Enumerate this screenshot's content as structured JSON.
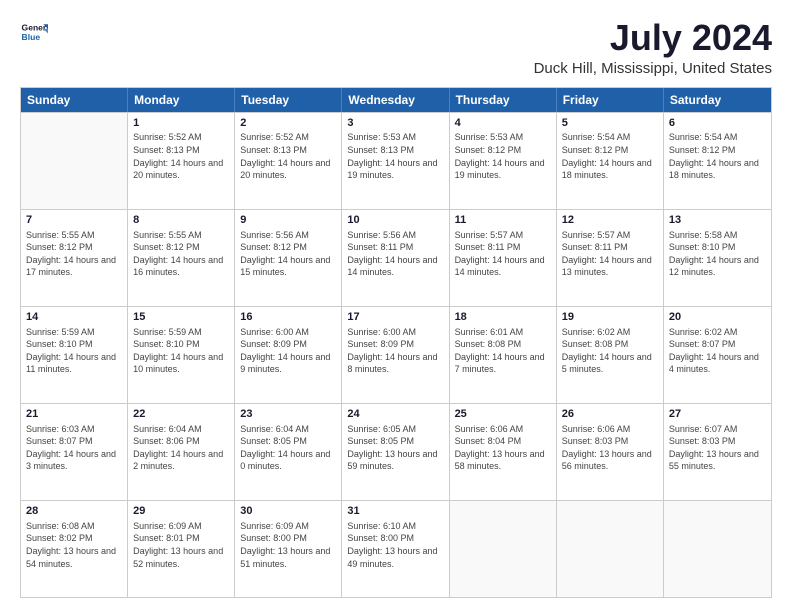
{
  "header": {
    "logo_line1": "General",
    "logo_line2": "Blue",
    "title": "July 2024",
    "subtitle": "Duck Hill, Mississippi, United States"
  },
  "weekdays": [
    "Sunday",
    "Monday",
    "Tuesday",
    "Wednesday",
    "Thursday",
    "Friday",
    "Saturday"
  ],
  "weeks": [
    [
      {
        "day": "",
        "empty": true
      },
      {
        "day": "1",
        "sunrise": "5:52 AM",
        "sunset": "8:13 PM",
        "daylight": "14 hours and 20 minutes."
      },
      {
        "day": "2",
        "sunrise": "5:52 AM",
        "sunset": "8:13 PM",
        "daylight": "14 hours and 20 minutes."
      },
      {
        "day": "3",
        "sunrise": "5:53 AM",
        "sunset": "8:13 PM",
        "daylight": "14 hours and 19 minutes."
      },
      {
        "day": "4",
        "sunrise": "5:53 AM",
        "sunset": "8:12 PM",
        "daylight": "14 hours and 19 minutes."
      },
      {
        "day": "5",
        "sunrise": "5:54 AM",
        "sunset": "8:12 PM",
        "daylight": "14 hours and 18 minutes."
      },
      {
        "day": "6",
        "sunrise": "5:54 AM",
        "sunset": "8:12 PM",
        "daylight": "14 hours and 18 minutes."
      }
    ],
    [
      {
        "day": "7",
        "sunrise": "5:55 AM",
        "sunset": "8:12 PM",
        "daylight": "14 hours and 17 minutes."
      },
      {
        "day": "8",
        "sunrise": "5:55 AM",
        "sunset": "8:12 PM",
        "daylight": "14 hours and 16 minutes."
      },
      {
        "day": "9",
        "sunrise": "5:56 AM",
        "sunset": "8:12 PM",
        "daylight": "14 hours and 15 minutes."
      },
      {
        "day": "10",
        "sunrise": "5:56 AM",
        "sunset": "8:11 PM",
        "daylight": "14 hours and 14 minutes."
      },
      {
        "day": "11",
        "sunrise": "5:57 AM",
        "sunset": "8:11 PM",
        "daylight": "14 hours and 14 minutes."
      },
      {
        "day": "12",
        "sunrise": "5:57 AM",
        "sunset": "8:11 PM",
        "daylight": "14 hours and 13 minutes."
      },
      {
        "day": "13",
        "sunrise": "5:58 AM",
        "sunset": "8:10 PM",
        "daylight": "14 hours and 12 minutes."
      }
    ],
    [
      {
        "day": "14",
        "sunrise": "5:59 AM",
        "sunset": "8:10 PM",
        "daylight": "14 hours and 11 minutes."
      },
      {
        "day": "15",
        "sunrise": "5:59 AM",
        "sunset": "8:10 PM",
        "daylight": "14 hours and 10 minutes."
      },
      {
        "day": "16",
        "sunrise": "6:00 AM",
        "sunset": "8:09 PM",
        "daylight": "14 hours and 9 minutes."
      },
      {
        "day": "17",
        "sunrise": "6:00 AM",
        "sunset": "8:09 PM",
        "daylight": "14 hours and 8 minutes."
      },
      {
        "day": "18",
        "sunrise": "6:01 AM",
        "sunset": "8:08 PM",
        "daylight": "14 hours and 7 minutes."
      },
      {
        "day": "19",
        "sunrise": "6:02 AM",
        "sunset": "8:08 PM",
        "daylight": "14 hours and 5 minutes."
      },
      {
        "day": "20",
        "sunrise": "6:02 AM",
        "sunset": "8:07 PM",
        "daylight": "14 hours and 4 minutes."
      }
    ],
    [
      {
        "day": "21",
        "sunrise": "6:03 AM",
        "sunset": "8:07 PM",
        "daylight": "14 hours and 3 minutes."
      },
      {
        "day": "22",
        "sunrise": "6:04 AM",
        "sunset": "8:06 PM",
        "daylight": "14 hours and 2 minutes."
      },
      {
        "day": "23",
        "sunrise": "6:04 AM",
        "sunset": "8:05 PM",
        "daylight": "14 hours and 0 minutes."
      },
      {
        "day": "24",
        "sunrise": "6:05 AM",
        "sunset": "8:05 PM",
        "daylight": "13 hours and 59 minutes."
      },
      {
        "day": "25",
        "sunrise": "6:06 AM",
        "sunset": "8:04 PM",
        "daylight": "13 hours and 58 minutes."
      },
      {
        "day": "26",
        "sunrise": "6:06 AM",
        "sunset": "8:03 PM",
        "daylight": "13 hours and 56 minutes."
      },
      {
        "day": "27",
        "sunrise": "6:07 AM",
        "sunset": "8:03 PM",
        "daylight": "13 hours and 55 minutes."
      }
    ],
    [
      {
        "day": "28",
        "sunrise": "6:08 AM",
        "sunset": "8:02 PM",
        "daylight": "13 hours and 54 minutes."
      },
      {
        "day": "29",
        "sunrise": "6:09 AM",
        "sunset": "8:01 PM",
        "daylight": "13 hours and 52 minutes."
      },
      {
        "day": "30",
        "sunrise": "6:09 AM",
        "sunset": "8:00 PM",
        "daylight": "13 hours and 51 minutes."
      },
      {
        "day": "31",
        "sunrise": "6:10 AM",
        "sunset": "8:00 PM",
        "daylight": "13 hours and 49 minutes."
      },
      {
        "day": "",
        "empty": true
      },
      {
        "day": "",
        "empty": true
      },
      {
        "day": "",
        "empty": true
      }
    ]
  ]
}
